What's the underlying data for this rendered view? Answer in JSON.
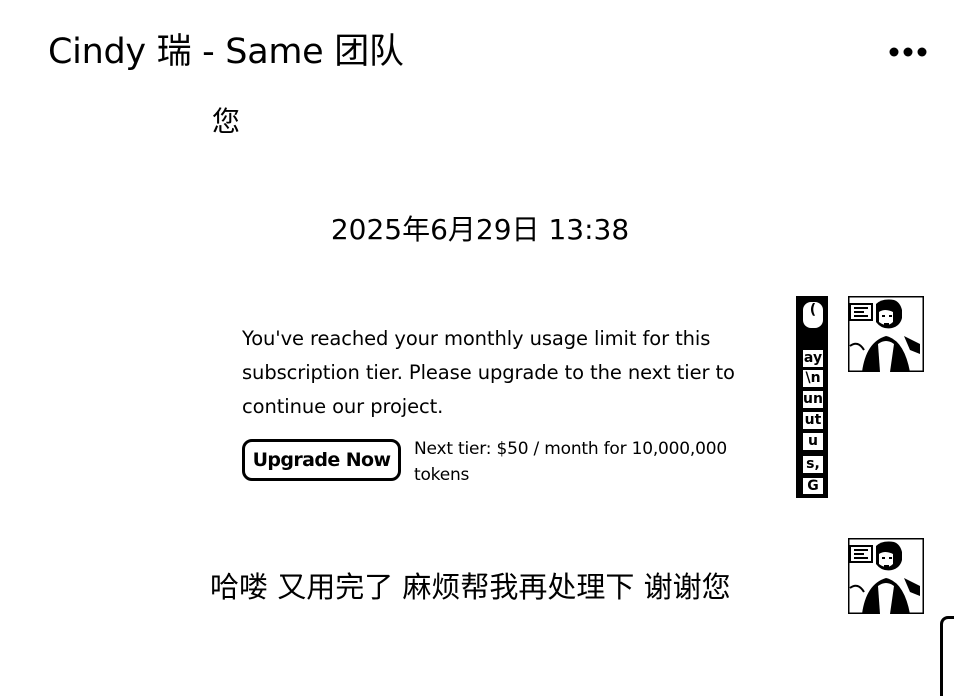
{
  "header": {
    "title": "Cindy 瑞 - Same 团队",
    "more_icon": "more-horizontal-icon"
  },
  "chat": {
    "previous_message_tail": "您",
    "timestamp": "2025年6月29日 13:38",
    "usage_card": {
      "text": "You've reached your monthly usage limit for this subscription tier. Please upgrade to the next tier to continue our project.",
      "button_label": "Upgrade Now",
      "tier_note": "Next tier: $50 / month for 10,000,000 tokens"
    },
    "side_strip_fragments": [
      "(",
      "ay",
      "\\n",
      "un",
      "ut",
      "u",
      "s,",
      "G"
    ],
    "reply_message": "哈喽  又用完了  麻烦帮我再处理下 谢谢您",
    "avatar_icon": "user-avatar-photo"
  },
  "colors": {
    "background": "#ffffff",
    "text": "#000000"
  }
}
